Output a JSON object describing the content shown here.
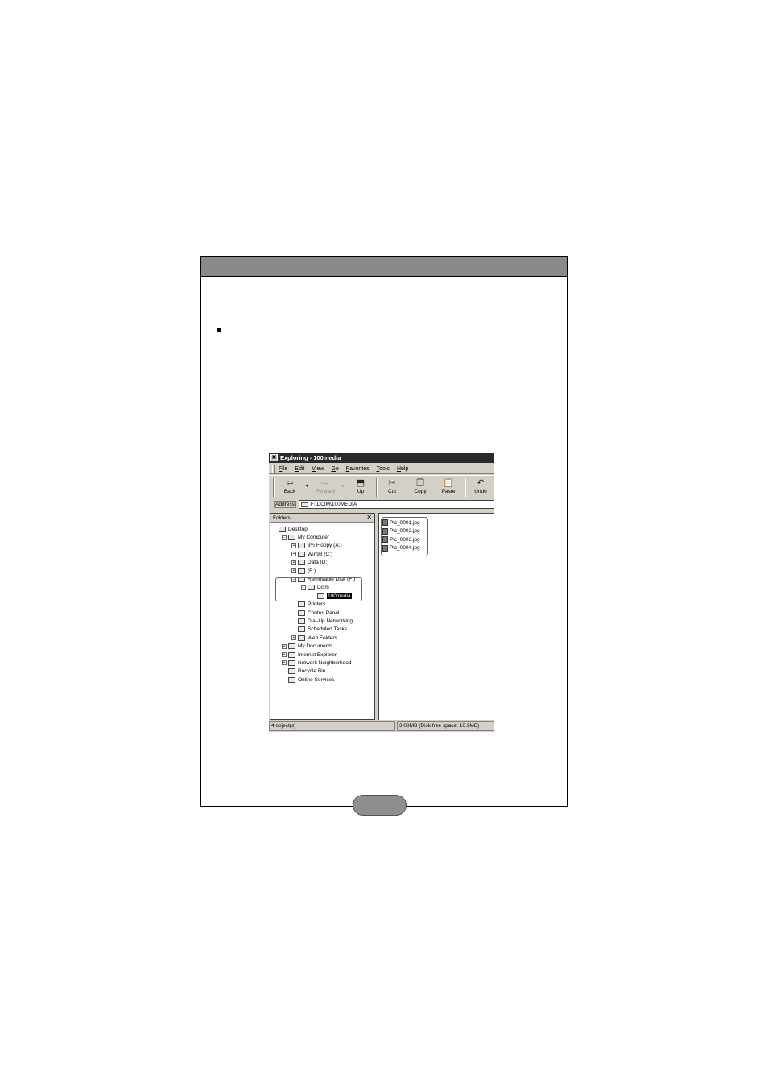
{
  "explorer": {
    "title": "Exploring - 100media",
    "menu": [
      "File",
      "Edit",
      "View",
      "Go",
      "Favorites",
      "Tools",
      "Help"
    ],
    "toolbar": {
      "back": "Back",
      "forward": "Forward",
      "up": "Up",
      "cut": "Cut",
      "copy": "Copy",
      "paste": "Paste",
      "undo": "Undo"
    },
    "address": {
      "label": "Address",
      "value": "F:\\DCIM\\100MEDIA"
    },
    "folders": {
      "header": "Folders",
      "items": [
        {
          "label": "Desktop",
          "level": 0,
          "expander": ""
        },
        {
          "label": "My Computer",
          "level": 1,
          "expander": "−"
        },
        {
          "label": "3½ Floppy (A:)",
          "level": 2,
          "expander": "+"
        },
        {
          "label": "Win98 (C:)",
          "level": 2,
          "expander": "+"
        },
        {
          "label": "Data (D:)",
          "level": 2,
          "expander": "+"
        },
        {
          "label": "(E:)",
          "level": 2,
          "expander": "+"
        },
        {
          "label": "Removable Disk (F:)",
          "level": 2,
          "expander": "−"
        },
        {
          "label": "Dcim",
          "level": 3,
          "expander": "−"
        },
        {
          "label": "100media",
          "level": 4,
          "expander": "",
          "selected": true
        },
        {
          "label": "Printers",
          "level": 2,
          "expander": ""
        },
        {
          "label": "Control Panel",
          "level": 2,
          "expander": ""
        },
        {
          "label": "Dial-Up Networking",
          "level": 2,
          "expander": ""
        },
        {
          "label": "Scheduled Tasks",
          "level": 2,
          "expander": ""
        },
        {
          "label": "Web Folders",
          "level": 2,
          "expander": "+"
        },
        {
          "label": "My Documents",
          "level": 1,
          "expander": "+"
        },
        {
          "label": "Internet Explorer",
          "level": 1,
          "expander": "+"
        },
        {
          "label": "Network Neighborhood",
          "level": 1,
          "expander": "+"
        },
        {
          "label": "Recycle Bin",
          "level": 1,
          "expander": ""
        },
        {
          "label": "Online Services",
          "level": 1,
          "expander": ""
        }
      ]
    },
    "files": [
      "Pic_0001.jpg",
      "Pic_0002.jpg",
      "Pic_0003.jpg",
      "Pic_0004.jpg"
    ],
    "status": {
      "left": "4 object(s)",
      "right": "3.08MB (Disk free space: 10.9MB)"
    }
  }
}
